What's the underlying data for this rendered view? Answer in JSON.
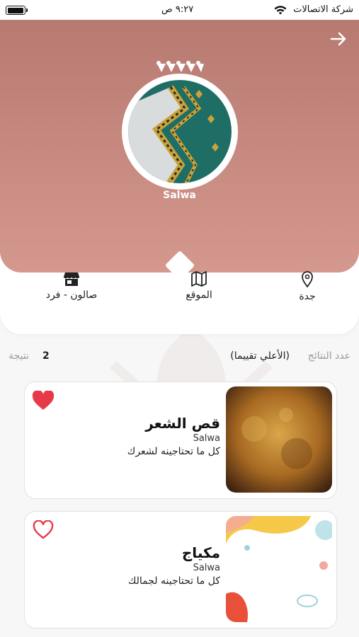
{
  "status_bar": {
    "carrier": "شركة الاتصالات",
    "time": "٩:٢٧ ص"
  },
  "profile": {
    "name": "Salwa",
    "header_color_top": "#b77a70",
    "header_color_bottom": "#d4988f"
  },
  "info": {
    "city": "جدة",
    "location": "الموقع",
    "salon_type": "صالون - فرد"
  },
  "results": {
    "count_label": "عدد النتائج",
    "sort_label": "(الأعلي تقييما)",
    "count": "2",
    "unit": "نتيجة"
  },
  "services": [
    {
      "title": "قص الشعر",
      "salon": "Salwa",
      "description": "كل ما تحتاجينه لشعرك",
      "favorited": true
    },
    {
      "title": "مكياج",
      "salon": "Salwa",
      "description": "كل ما تحتاجينه لجمالك",
      "favorited": false
    }
  ],
  "colors": {
    "favorite_red": "#e8394a"
  }
}
